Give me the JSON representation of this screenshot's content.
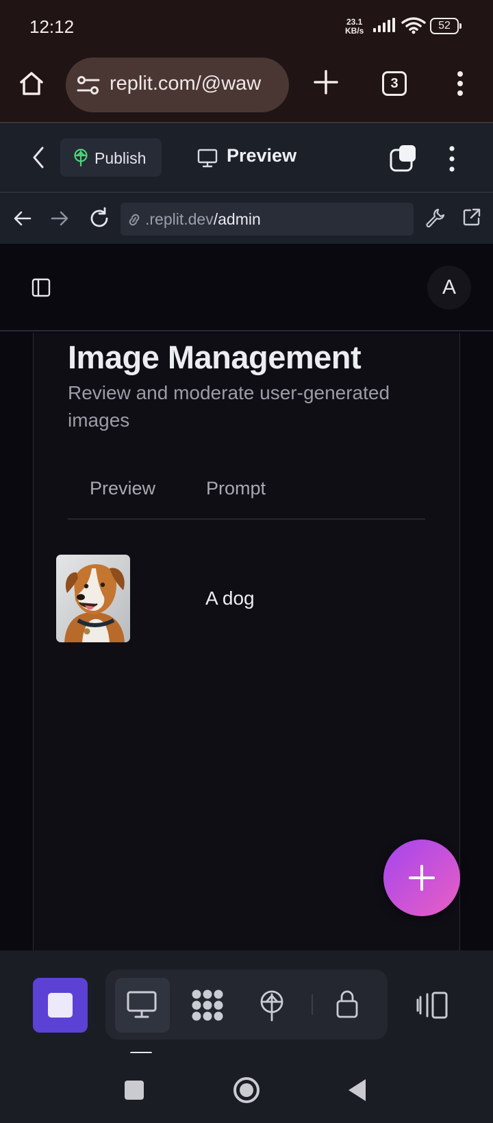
{
  "status_bar": {
    "time": "12:12",
    "net_rate": "23.1",
    "net_unit": "KB/s",
    "battery": "52"
  },
  "browser": {
    "url": "replit.com/@waw",
    "tab_count": "3"
  },
  "replit_header": {
    "publish_label": "Publish",
    "preview_label": "Preview"
  },
  "nav_bar": {
    "address_host": ".replit.dev",
    "address_path": "/admin"
  },
  "app": {
    "avatar_letter": "A",
    "title": "Image Management",
    "subtitle": "Review and moderate user-generated images",
    "table": {
      "columns": [
        "Preview",
        "Prompt"
      ],
      "rows": [
        {
          "prompt": "A dog",
          "thumbnail": "dog-image"
        }
      ]
    }
  },
  "colors": {
    "accent": "#5b42d4",
    "fab_gradient_start": "#a545ef",
    "fab_gradient_end": "#e95fc3",
    "publish_icon": "#4cd97a"
  },
  "icons": [
    "home-icon",
    "site-settings-icon",
    "new-tab-icon",
    "tab-switcher-icon",
    "browser-menu-icon",
    "back-chevron-icon",
    "publish-icon",
    "monitor-icon",
    "tabs-icon",
    "more-icon",
    "arrow-back-icon",
    "arrow-forward-icon",
    "reload-icon",
    "link-icon",
    "wrench-icon",
    "open-external-icon",
    "sidebar-toggle-icon",
    "plus-icon",
    "stop-icon",
    "preview-tool-icon",
    "extensions-tool-icon",
    "deploy-tool-icon",
    "secrets-lock-icon",
    "panels-icon"
  ]
}
